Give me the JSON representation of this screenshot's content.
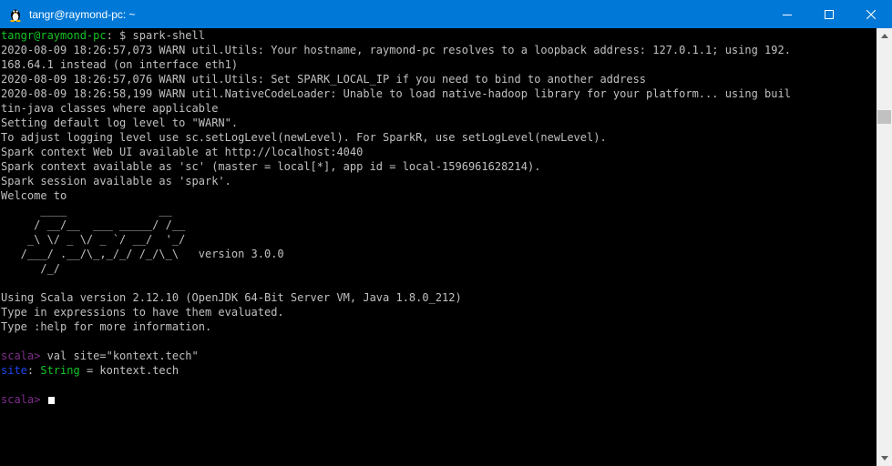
{
  "window": {
    "title": "tangr@raymond-pc: ~",
    "icon": "tux-icon",
    "controls": [
      "minimize-icon",
      "maximize-icon",
      "close-icon"
    ]
  },
  "terminal": {
    "prompt_user": "tangr@raymond-pc",
    "prompt_path": ": $ ",
    "command": "spark-shell",
    "log_lines": [
      "2020-08-09 18:26:57,073 WARN util.Utils: Your hostname, raymond-pc resolves to a loopback address: 127.0.1.1; using 192.",
      "168.64.1 instead (on interface eth1)",
      "2020-08-09 18:26:57,076 WARN util.Utils: Set SPARK_LOCAL_IP if you need to bind to another address",
      "2020-08-09 18:26:58,199 WARN util.NativeCodeLoader: Unable to load native-hadoop library for your platform... using buil",
      "tin-java classes where applicable",
      "Setting default log level to \"WARN\".",
      "To adjust logging level use sc.setLogLevel(newLevel). For SparkR, use setLogLevel(newLevel).",
      "Spark context Web UI available at http://localhost:4040",
      "Spark context available as 'sc' (master = local[*], app id = local-1596961628214).",
      "Spark session available as 'spark'.",
      "Welcome to"
    ],
    "banner": [
      "      ____              __",
      "     / __/__  ___ _____/ /__",
      "    _\\ \\/ _ \\/ _ `/ __/  '_/",
      "   /___/ .__/\\_,_/_/ /_/\\_\\   version 3.0.0",
      "      /_/"
    ],
    "info_lines": [
      "Using Scala version 2.12.10 (OpenJDK 64-Bit Server VM, Java 1.8.0_212)",
      "Type in expressions to have them evaluated.",
      "Type :help for more information."
    ],
    "scala_prompt": "scala>",
    "repl_input": " val site=\"kontext.tech\"",
    "result_name": "site",
    "result_sep": ": ",
    "result_type": "String",
    "result_value": " = kontext.tech"
  },
  "colors": {
    "titlebar": "#0078d7",
    "prompt_green": "#13c627",
    "scala_prompt_purple": "#7e2d8c",
    "result_name_blue": "#1d45f0",
    "text": "#c0c0c0"
  }
}
